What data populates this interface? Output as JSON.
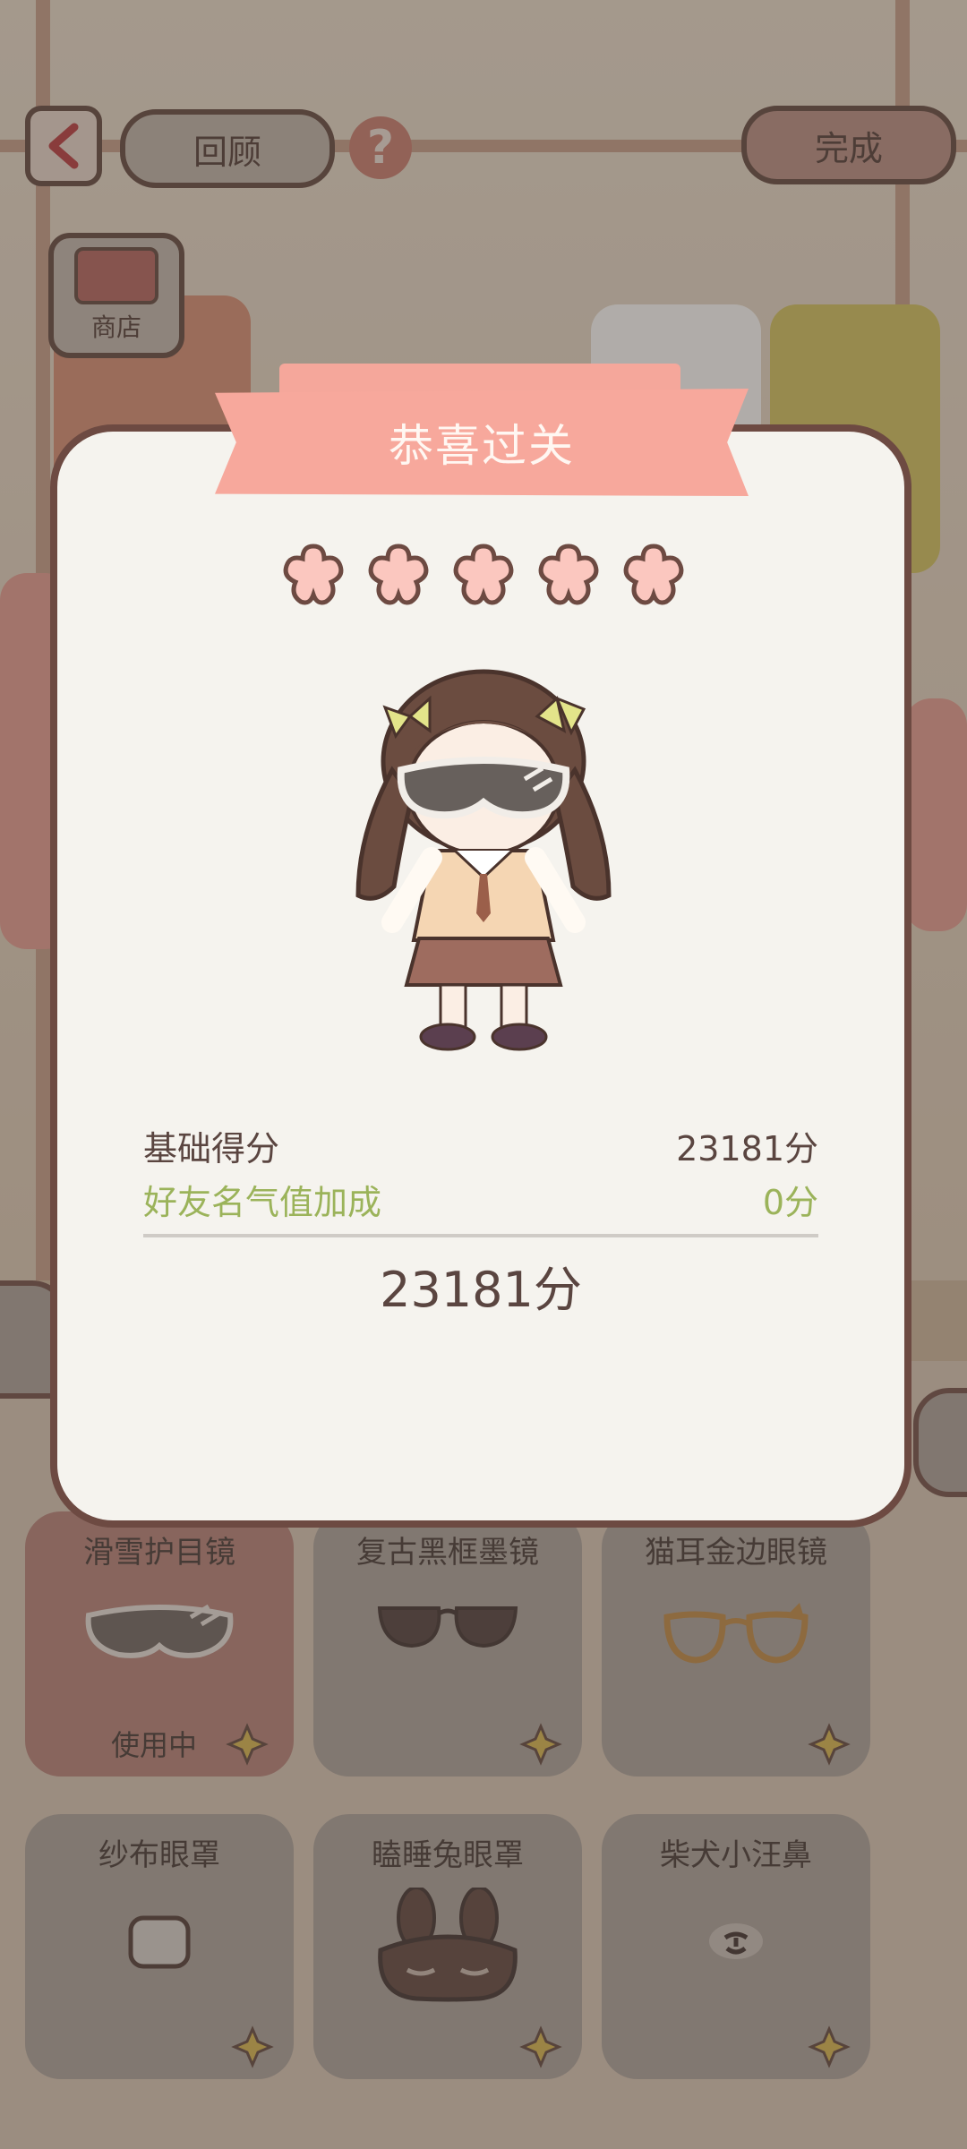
{
  "topbar": {
    "back_icon": "chevron-left-icon",
    "review_label": "回顾",
    "help_icon": "question-icon",
    "done_label": "完成"
  },
  "shop": {
    "label": "商店",
    "icon": "shop-icon"
  },
  "dialog": {
    "title": "恭喜过关",
    "stars": [
      1,
      1,
      1,
      1,
      1
    ],
    "base_score_label": "基础得分",
    "base_score_value": "23181分",
    "bonus_label": "好友名气值加成",
    "bonus_value": "0分",
    "total": "23181分"
  },
  "items": [
    {
      "name": "滑雪护目镜",
      "status": "使用中",
      "icon": "ski-goggles-icon"
    },
    {
      "name": "复古黑框墨镜",
      "icon": "sunglasses-icon"
    },
    {
      "name": "猫耳金边眼镜",
      "icon": "cat-ear-glasses-icon"
    },
    {
      "name": "纱布眼罩",
      "icon": "gauze-eyepatch-icon"
    },
    {
      "name": "瞌睡兔眼罩",
      "icon": "bunny-sleep-mask-icon"
    },
    {
      "name": "柴犬小汪鼻",
      "icon": "dog-nose-icon"
    }
  ],
  "colors": {
    "accent": "#f7a89c",
    "border": "#6d4a42",
    "bonus": "#9bb35a",
    "dialog_bg": "#f5f3ee"
  }
}
